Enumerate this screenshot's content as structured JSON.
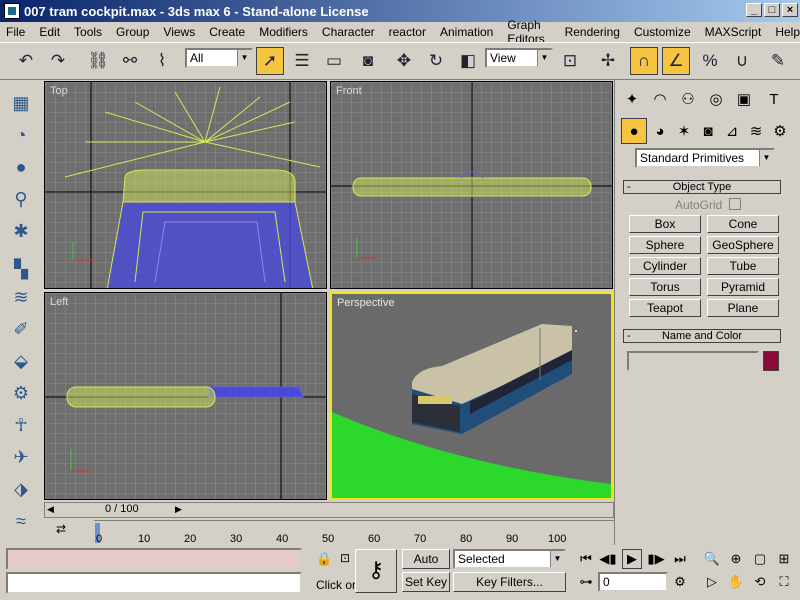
{
  "window": {
    "title": "007 tram cockpit.max - 3ds max 6 - Stand-alone License",
    "minimize": "_",
    "maximize": "□",
    "close": "×"
  },
  "menu": [
    "File",
    "Edit",
    "Tools",
    "Group",
    "Views",
    "Create",
    "Modifiers",
    "Character",
    "reactor",
    "Animation",
    "Graph Editors",
    "Rendering",
    "Customize",
    "MAXScript",
    "Help"
  ],
  "toolbar": {
    "selection_filter": "All",
    "ref_coord": "View"
  },
  "viewports": {
    "top": "Top",
    "front": "Front",
    "left": "Left",
    "perspective": "Perspective"
  },
  "command_panel": {
    "category": "Standard Primitives",
    "object_type_title": "Object Type",
    "autogrid_label": "AutoGrid",
    "buttons": [
      "Box",
      "Cone",
      "Sphere",
      "GeoSphere",
      "Cylinder",
      "Tube",
      "Torus",
      "Pyramid",
      "Teapot",
      "Plane"
    ],
    "name_color_title": "Name and Color",
    "name_value": "",
    "object_color": "#8b0a3a",
    "rollout_minus": "-"
  },
  "timeline": {
    "frame_display": "0 / 100",
    "ticks": [
      "0",
      "10",
      "20",
      "30",
      "40",
      "50",
      "60",
      "70",
      "80",
      "90",
      "100"
    ]
  },
  "status": {
    "prompt": "Click or",
    "auto_key": "Auto Key",
    "set_key": "Set Key",
    "key_mode": "Selected",
    "key_filters": "Key Filters...",
    "current_frame": "0"
  },
  "colors": {
    "title_start": "#0a246a",
    "title_end": "#a6caf0",
    "active_viewport": "#f2e31a",
    "wireframe": "#d4e858",
    "wire_blue": "#4a4ad8",
    "ground": "#2bd82b"
  }
}
